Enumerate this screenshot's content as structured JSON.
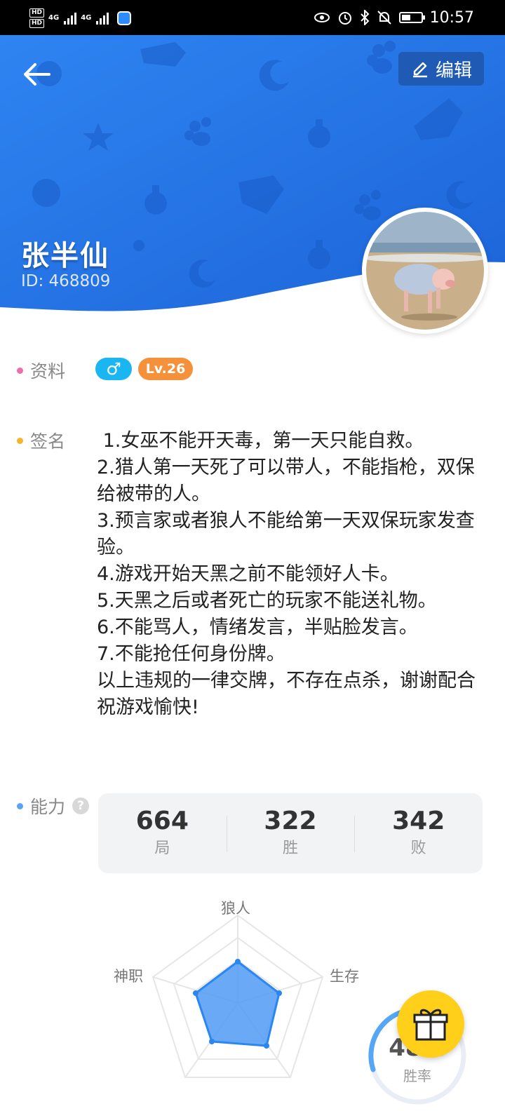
{
  "status_bar": {
    "network_1": "4G",
    "network_2": "4G",
    "hd_1": "HD",
    "hd_2": "HD",
    "time": "10:57",
    "icons": [
      "eye-icon",
      "alarm-icon",
      "bluetooth-icon",
      "mute-icon",
      "battery-icon"
    ]
  },
  "header": {
    "edit_label": "编辑",
    "name": "张半仙",
    "id_text": "ID: 468809",
    "accent": "#2d7ff0"
  },
  "profile": {
    "label": "资料",
    "gender_symbol": "♂",
    "level": "Lv.26"
  },
  "signature": {
    "label": "签名",
    "text": " 1.女巫不能开天毒，第一天只能自救。\n2.猎人第一天死了可以带人，不能指枪，双保给被带的人。\n3.预言家或者狼人不能给第一天双保玩家发查验。\n4.游戏开始天黑之前不能领好人卡。\n5.天黑之后或者死亡的玩家不能送礼物。\n6.不能骂人，情绪发言，半贴脸发言。\n7.不能抢任何身份牌。\n以上违规的一律交牌，不存在点杀，谢谢配合祝游戏愉快!"
  },
  "ability": {
    "label": "能力",
    "help": "?",
    "stats": [
      {
        "value": "664",
        "label": "局"
      },
      {
        "value": "322",
        "label": "胜"
      },
      {
        "value": "342",
        "label": "败"
      }
    ],
    "radar_labels": {
      "top": "狼人",
      "right": "生存",
      "left": "神职"
    },
    "winrate_label": "胜率",
    "winrate_value": "48%"
  }
}
